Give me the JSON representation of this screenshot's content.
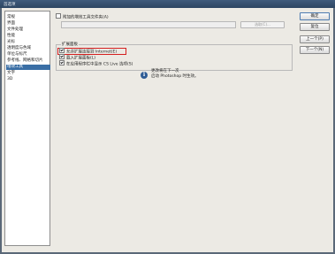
{
  "window": {
    "title": "首选项"
  },
  "sidebar": {
    "items": [
      {
        "label": "常规"
      },
      {
        "label": "界面"
      },
      {
        "label": "文件处理"
      },
      {
        "label": "性能"
      },
      {
        "label": "光标"
      },
      {
        "label": "透明度与色域"
      },
      {
        "label": "单位与标尺"
      },
      {
        "label": "参考线、网格和切片"
      },
      {
        "label": "增效工具"
      },
      {
        "label": "文字"
      },
      {
        "label": "3D"
      }
    ],
    "selected_index": 8
  },
  "panel": {
    "additional_plugins_label": "附加的增效工具文件夹(A)",
    "additional_plugins_path": "",
    "choose_button": "选取(C)...",
    "extension_panels": {
      "title": "扩展面板",
      "options": [
        {
          "label": "允许扩展连接到 Internet(E)",
          "checked": true,
          "highlighted": true
        },
        {
          "label": "载入扩展面板(L)",
          "checked": true
        },
        {
          "label": "在应用程序栏中显示 CS Live 选项(S)",
          "checked": true
        }
      ]
    },
    "info": {
      "line1": "更改将在下一次",
      "line2": "启动 Photoshop 时生效。"
    }
  },
  "buttons": {
    "ok": "确定",
    "reset": "复位",
    "prev": "上一个(P)",
    "next": "下一个(N)"
  },
  "colors": {
    "selection": "#3a6ea5",
    "highlight_box": "#d52020",
    "dialog_bg": "#eceae4"
  }
}
